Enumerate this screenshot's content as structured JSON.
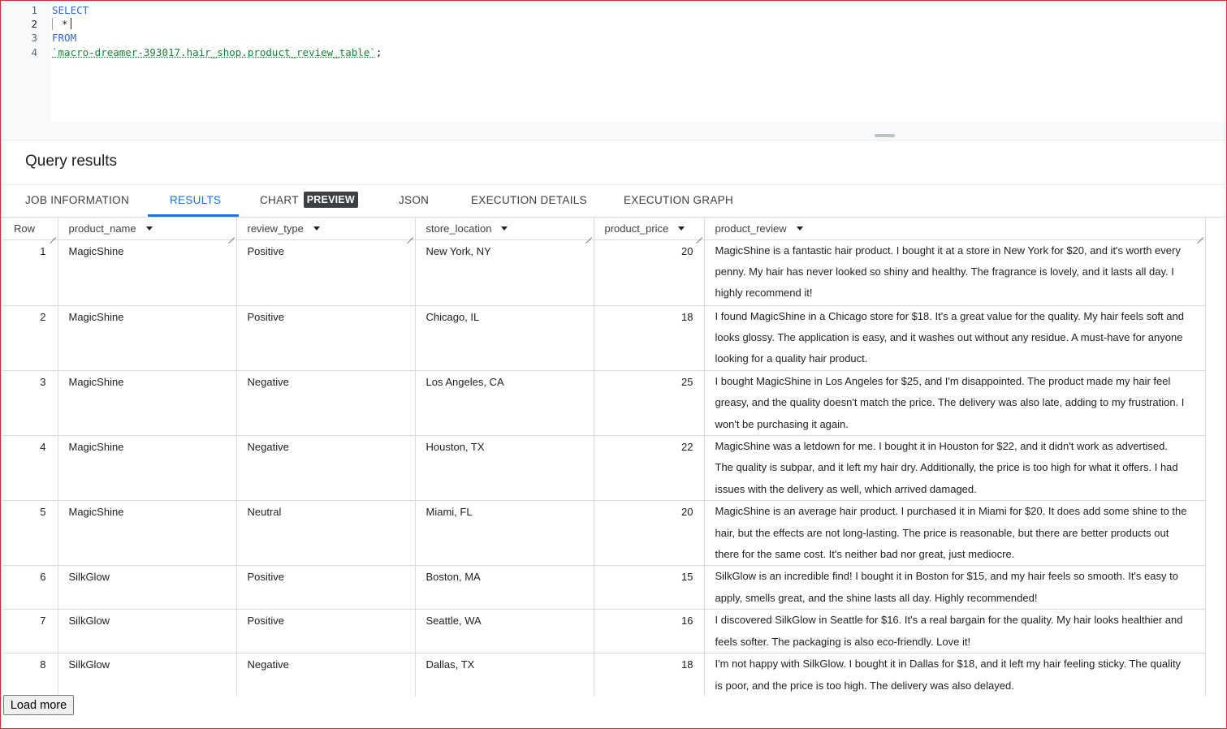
{
  "editor": {
    "lines": [
      {
        "n": "1",
        "keyword": "SELECT"
      },
      {
        "n": "2",
        "text": "*"
      },
      {
        "n": "3",
        "keyword": "FROM"
      },
      {
        "n": "4",
        "table": "`macro-dreamer-393017.hair_shop.product_review_table`",
        "end": ";"
      }
    ]
  },
  "results": {
    "title": "Query results",
    "tabs": [
      {
        "label": "JOB INFORMATION"
      },
      {
        "label": "RESULTS"
      },
      {
        "label": "CHART",
        "badge": "PREVIEW"
      },
      {
        "label": "JSON"
      },
      {
        "label": "EXECUTION DETAILS"
      },
      {
        "label": "EXECUTION GRAPH"
      }
    ],
    "active_tab": "RESULTS",
    "columns": [
      "Row",
      "product_name",
      "review_type",
      "store_location",
      "product_price",
      "product_review"
    ],
    "rows": [
      {
        "row": "1",
        "product_name": "MagicShine",
        "review_type": "Positive",
        "store_location": "New York, NY",
        "product_price": "20",
        "product_review": "MagicShine is a fantastic hair product. I bought it at a store in New York for $20, and it's worth every penny. My hair has never looked so shiny and healthy. The fragrance is lovely, and it lasts all day. I highly recommend it!"
      },
      {
        "row": "2",
        "product_name": "MagicShine",
        "review_type": "Positive",
        "store_location": "Chicago, IL",
        "product_price": "18",
        "product_review": "I found MagicShine in a Chicago store for $18. It's a great value for the quality. My hair feels soft and looks glossy. The application is easy, and it washes out without any residue. A must-have for anyone looking for a quality hair product."
      },
      {
        "row": "3",
        "product_name": "MagicShine",
        "review_type": "Negative",
        "store_location": "Los Angeles, CA",
        "product_price": "25",
        "product_review": "I bought MagicShine in Los Angeles for $25, and I'm disappointed. The product made my hair feel greasy, and the quality doesn't match the price. The delivery was also late, adding to my frustration. I won't be purchasing it again."
      },
      {
        "row": "4",
        "product_name": "MagicShine",
        "review_type": "Negative",
        "store_location": "Houston, TX",
        "product_price": "22",
        "product_review": "MagicShine was a letdown for me. I bought it in Houston for $22, and it didn't work as advertised. The quality is subpar, and it left my hair dry. Additionally, the price is too high for what it offers. I had issues with the delivery as well, which arrived damaged."
      },
      {
        "row": "5",
        "product_name": "MagicShine",
        "review_type": "Neutral",
        "store_location": "Miami, FL",
        "product_price": "20",
        "product_review": "MagicShine is an average hair product. I purchased it in Miami for $20. It does add some shine to the hair, but the effects are not long-lasting. The price is reasonable, but there are better products out there for the same cost. It's neither bad nor great, just mediocre."
      },
      {
        "row": "6",
        "product_name": "SilkGlow",
        "review_type": "Positive",
        "store_location": "Boston, MA",
        "product_price": "15",
        "product_review": "SilkGlow is an incredible find! I bought it in Boston for $15, and my hair feels so smooth. It's easy to apply, smells great, and the shine lasts all day. Highly recommended!"
      },
      {
        "row": "7",
        "product_name": "SilkGlow",
        "review_type": "Positive",
        "store_location": "Seattle, WA",
        "product_price": "16",
        "product_review": "I discovered SilkGlow in Seattle for $16. It's a real bargain for the quality. My hair looks healthier and feels softer. The packaging is also eco-friendly. Love it!"
      },
      {
        "row": "8",
        "product_name": "SilkGlow",
        "review_type": "Negative",
        "store_location": "Dallas, TX",
        "product_price": "18",
        "product_review": "I'm not happy with SilkGlow. I bought it in Dallas for $18, and it left my hair feeling sticky. The quality is poor, and the price is too high. The delivery was also delayed."
      }
    ],
    "load_more_label": "Load more"
  }
}
